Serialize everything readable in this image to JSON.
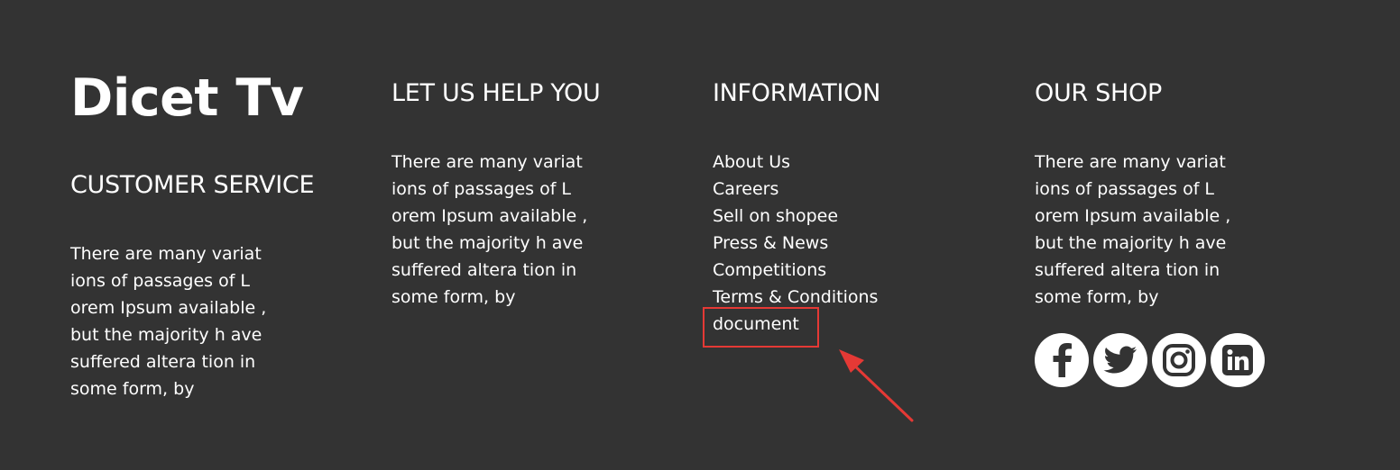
{
  "brand": {
    "logo_text": "Dicet Tv"
  },
  "columns": [
    {
      "heading": "CUSTOMER SERVICE",
      "text": "There are many variat\nions of passages of L\norem Ipsum available ,\nbut the majority h ave\nsuffered altera tion in\nsome form, by"
    },
    {
      "heading": "LET US HELP YOU",
      "text": "There are many variat\nions of passages of L\norem Ipsum available ,\nbut the majority h ave\nsuffered altera tion in\nsome form, by"
    },
    {
      "heading": "INFORMATION",
      "links": [
        "About Us",
        "Careers",
        "Sell on shopee",
        "Press & News",
        "Competitions",
        "Terms & Conditions",
        "document"
      ]
    },
    {
      "heading": "OUR SHOP",
      "text": "There are many variat\nions of passages of L\norem Ipsum available ,\nbut the majority h ave\nsuffered altera tion in\nsome form, by"
    }
  ],
  "social_icons": [
    "facebook-icon",
    "twitter-icon",
    "instagram-icon",
    "linkedin-icon"
  ],
  "colors": {
    "background": "#333333",
    "text": "#ffffff",
    "highlight": "#e53935"
  }
}
